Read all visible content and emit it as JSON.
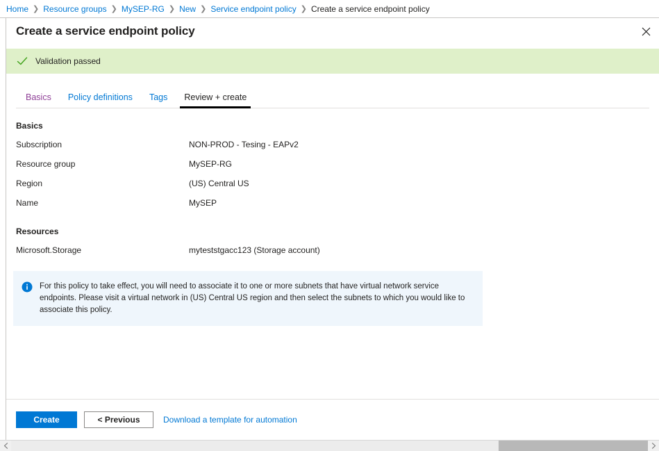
{
  "breadcrumb": {
    "separator": "❯",
    "items": [
      {
        "label": "Home",
        "current": false
      },
      {
        "label": "Resource groups",
        "current": false
      },
      {
        "label": "MySEP-RG",
        "current": false
      },
      {
        "label": "New",
        "current": false
      },
      {
        "label": "Service endpoint policy",
        "current": false
      },
      {
        "label": "Create a service endpoint policy",
        "current": true
      }
    ]
  },
  "blade": {
    "title": "Create a service endpoint policy",
    "close_icon": "close-icon"
  },
  "validation": {
    "icon": "checkmark-icon",
    "text": "Validation passed",
    "background_color": "#dff0c9",
    "icon_color": "#107c10"
  },
  "tabs": [
    {
      "label": "Basics",
      "state": "visited"
    },
    {
      "label": "Policy definitions",
      "state": "link"
    },
    {
      "label": "Tags",
      "state": "link"
    },
    {
      "label": "Review + create",
      "state": "active"
    }
  ],
  "summary": {
    "basics": {
      "heading": "Basics",
      "rows": [
        {
          "key": "Subscription",
          "value": "NON-PROD - Tesing - EAPv2"
        },
        {
          "key": "Resource group",
          "value": "MySEP-RG"
        },
        {
          "key": "Region",
          "value": "(US) Central US"
        },
        {
          "key": "Name",
          "value": "MySEP"
        }
      ]
    },
    "resources": {
      "heading": "Resources",
      "rows": [
        {
          "key": "Microsoft.Storage",
          "value": "myteststgacc123 (Storage account)"
        }
      ]
    }
  },
  "info": {
    "icon": "info-icon",
    "text": "For this policy to take effect, you will need to associate it to one or more subnets that have virtual network service endpoints. Please visit a virtual network in (US) Central US region and then select the subnets to which you would like to associate this policy.",
    "background_color": "#eff6fc",
    "icon_color": "#0078d4"
  },
  "footer": {
    "create_label": "Create",
    "previous_label": "< Previous",
    "download_link_label": "Download a template for automation",
    "primary_color": "#0078d4"
  },
  "scrollbar": {
    "left_arrow_icon": "chevron-left-icon",
    "right_arrow_icon": "chevron-right-icon"
  }
}
